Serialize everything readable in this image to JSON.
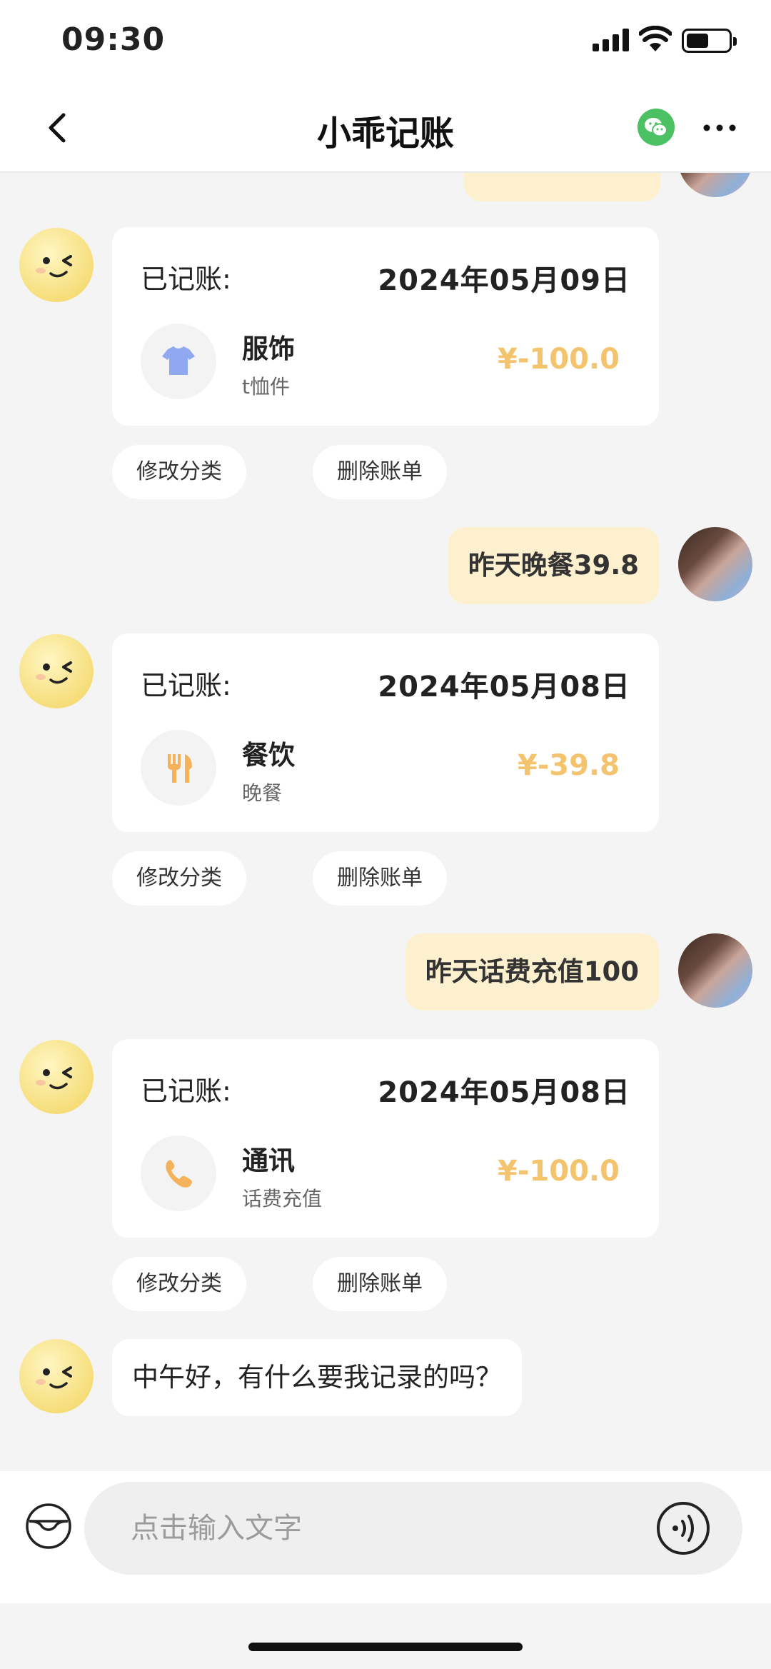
{
  "status_bar": {
    "time": "09:30"
  },
  "nav": {
    "title": "小乖记账"
  },
  "chat": {
    "records": [
      {
        "label": "已记账:",
        "date": "2024年05月09日",
        "category": "服饰",
        "note": "t恤件",
        "amount": "¥-100.0",
        "icon": "tshirt-icon"
      },
      {
        "label": "已记账:",
        "date": "2024年05月08日",
        "category": "餐饮",
        "note": "晚餐",
        "amount": "¥-39.8",
        "icon": "utensils-icon"
      },
      {
        "label": "已记账:",
        "date": "2024年05月08日",
        "category": "通讯",
        "note": "话费充值",
        "amount": "¥-100.0",
        "icon": "phone-icon"
      }
    ],
    "actions": {
      "modify": "修改分类",
      "delete": "删除账单"
    },
    "user_messages": [
      "昨天晚餐39.8",
      "昨天话费充值100"
    ],
    "bot_greeting": "中午好，有什么要我记录的吗？"
  },
  "input": {
    "placeholder": "点击输入文字"
  },
  "colors": {
    "amount": "#f4c36d",
    "user_bubble": "#fdf0cf",
    "background": "#f4f4f4"
  }
}
